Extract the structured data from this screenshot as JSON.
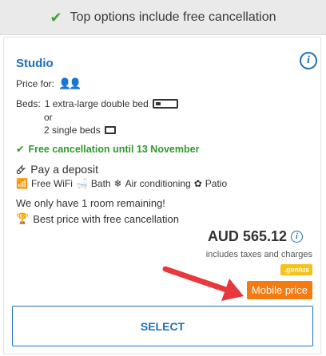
{
  "banner": {
    "text": "Top options include free cancellation"
  },
  "room": {
    "title": "Studio",
    "price_for_label": "Price for:",
    "beds_label": "Beds:",
    "bed_option_1": "1 extra-large double bed",
    "or_text": "or",
    "bed_option_2": "2 single beds",
    "free_cancellation": "Free cancellation until 13 November",
    "deposit": "Pay a deposit",
    "amenities": [
      "Free WiFi",
      "Bath",
      "Air conditioning",
      "Patio"
    ],
    "remaining": "We only have 1 room remaining!",
    "best_price": "Best price with free cancellation"
  },
  "pricing": {
    "price": "AUD 565.12",
    "taxes_note": "includes taxes and charges",
    "genius_badge": ".genius",
    "mobile_price_badge": "Mobile price"
  },
  "action": {
    "select_label": "SELECT"
  },
  "colors": {
    "accent_blue": "#1f6fb9",
    "success_green": "#2f9a2a",
    "mobile_orange": "#f47b12",
    "genius_yellow": "#f5c11b",
    "arrow_red": "#e8383d"
  }
}
